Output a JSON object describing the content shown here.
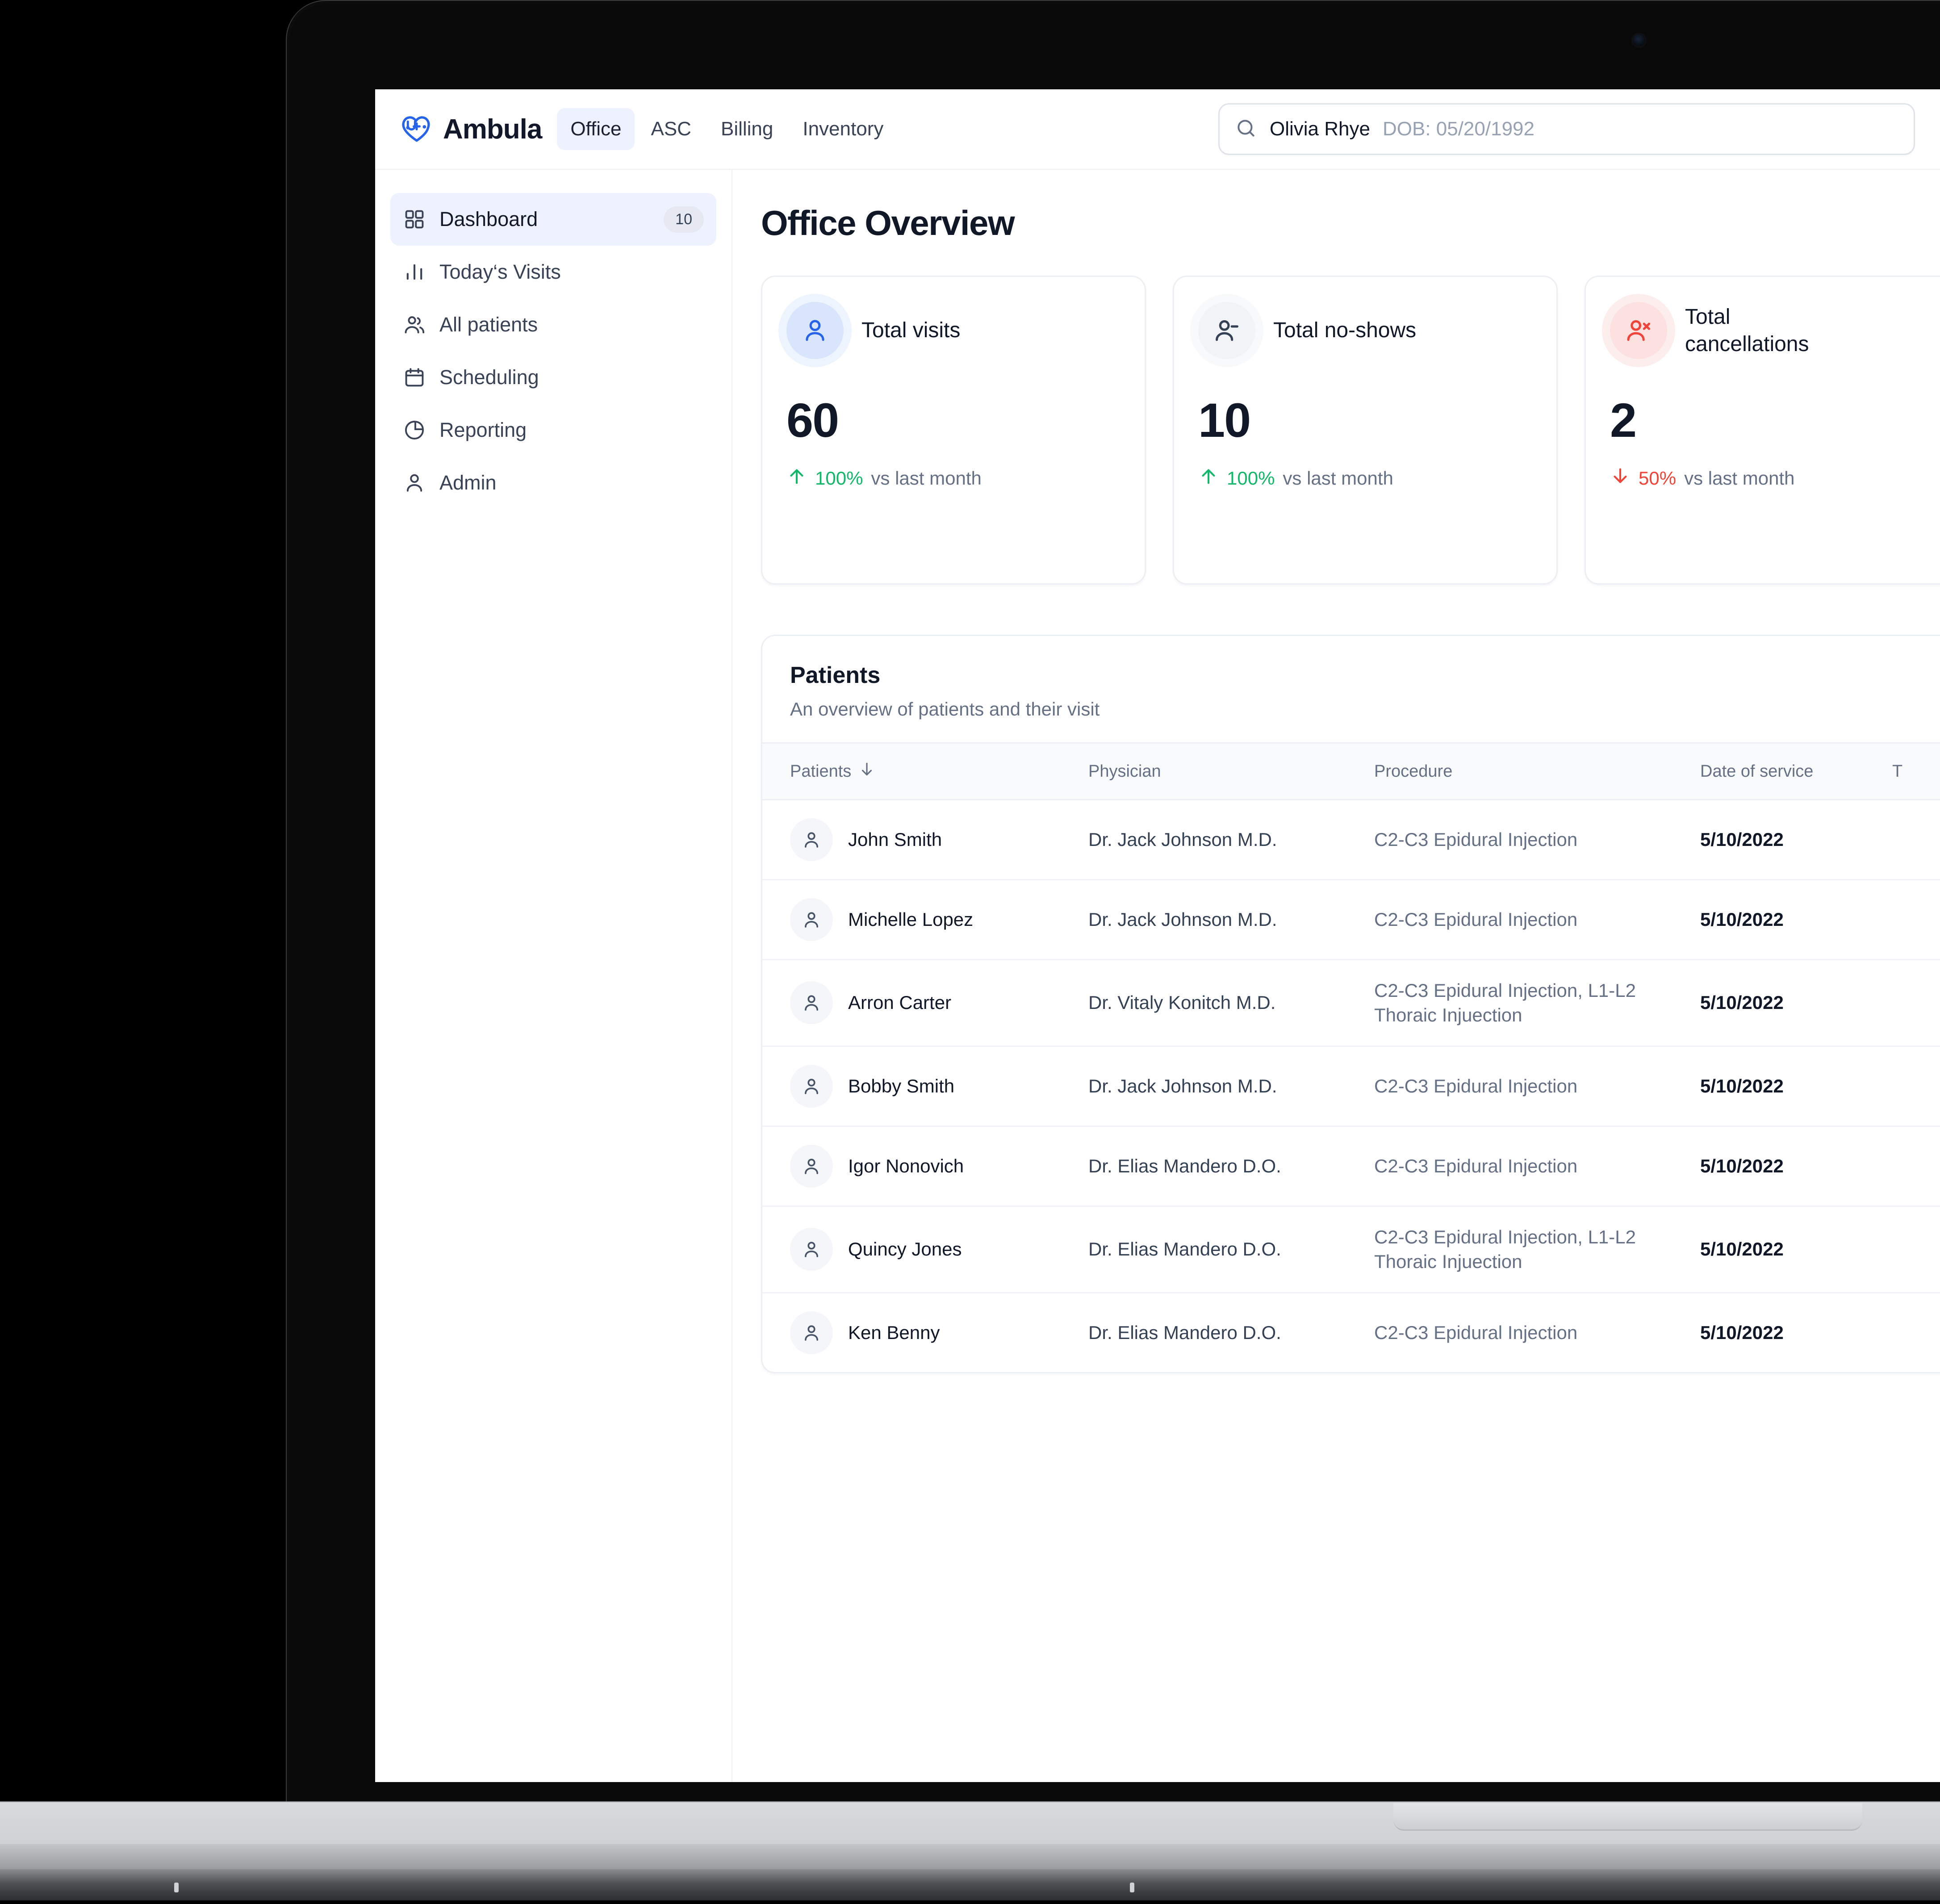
{
  "header": {
    "brand": "Ambula",
    "brand_icon": "heart-stethoscope-logo",
    "tabs": [
      {
        "label": "Office",
        "active": true
      },
      {
        "label": "ASC",
        "active": false
      },
      {
        "label": "Billing",
        "active": false
      },
      {
        "label": "Inventory",
        "active": false
      }
    ],
    "search": {
      "icon": "search-icon",
      "value": "Olivia Rhye",
      "dob": "DOB: 05/20/1992"
    }
  },
  "sidebar": {
    "items": [
      {
        "label": "Dashboard",
        "icon": "grid-icon",
        "badge": "10",
        "active": true
      },
      {
        "label": "Today‘s Visits",
        "icon": "bar-chart-icon",
        "badge": "",
        "active": false
      },
      {
        "label": "All patients",
        "icon": "users-icon",
        "badge": "",
        "active": false
      },
      {
        "label": "Scheduling",
        "icon": "calendar-icon",
        "badge": "",
        "active": false
      },
      {
        "label": "Reporting",
        "icon": "pie-chart-icon",
        "badge": "",
        "active": false
      },
      {
        "label": "Admin",
        "icon": "user-icon",
        "badge": "",
        "active": false
      }
    ]
  },
  "main": {
    "page_title": "Office Overview",
    "stats": [
      {
        "label": "Total visits",
        "value": "60",
        "icon": "user-icon",
        "tone": "blue",
        "delta_direction": "up",
        "delta_pct": "100%",
        "delta_note": "vs last month",
        "accent": "#2563EB"
      },
      {
        "label": "Total no-shows",
        "value": "10",
        "icon": "user-minus-icon",
        "tone": "gray",
        "delta_direction": "up",
        "delta_pct": "100%",
        "delta_note": "vs last month",
        "accent": "#344054"
      },
      {
        "label": "Total cancellations",
        "value": "2",
        "icon": "user-x-icon",
        "tone": "red",
        "delta_direction": "down",
        "delta_pct": "50%",
        "delta_note": "vs last month",
        "accent": "#F04438"
      }
    ],
    "table": {
      "title": "Patients",
      "subtitle": "An overview of patients and their visit",
      "columns": [
        {
          "label": "Patients",
          "sort": "↓"
        },
        {
          "label": "Physician",
          "sort": ""
        },
        {
          "label": "Procedure",
          "sort": ""
        },
        {
          "label": "Date of service",
          "sort": ""
        },
        {
          "label": "T",
          "sort": ""
        }
      ],
      "rows": [
        {
          "patient": "John Smith",
          "physician": "Dr. Jack Johnson M.D.",
          "procedure": "C2-C3 Epidural Injection",
          "date": "5/10/2022"
        },
        {
          "patient": "Michelle Lopez",
          "physician": "Dr. Jack Johnson M.D.",
          "procedure": "C2-C3 Epidural Injection",
          "date": "5/10/2022"
        },
        {
          "patient": "Arron Carter",
          "physician": "Dr. Vitaly Konitch M.D.",
          "procedure": "C2-C3 Epidural Injection, L1-L2 Thoraic Injuection",
          "date": "5/10/2022"
        },
        {
          "patient": "Bobby Smith",
          "physician": "Dr. Jack Johnson M.D.",
          "procedure": "C2-C3 Epidural Injection",
          "date": "5/10/2022"
        },
        {
          "patient": "Igor Nonovich",
          "physician": "Dr. Elias Mandero D.O.",
          "procedure": "C2-C3 Epidural Injection",
          "date": "5/10/2022"
        },
        {
          "patient": "Quincy Jones",
          "physician": "Dr. Elias Mandero D.O.",
          "procedure": "C2-C3 Epidural Injection, L1-L2 Thoraic Injuection",
          "date": "5/10/2022"
        },
        {
          "patient": "Ken Benny",
          "physician": "Dr. Elias Mandero D.O.",
          "procedure": "C2-C3 Epidural Injection",
          "date": "5/10/2022"
        }
      ]
    }
  },
  "theme": {
    "accent": "#2563EB",
    "accent_soft": "#EEF2FE",
    "text": "#101828",
    "muted": "#667085",
    "success": "#12B76A",
    "danger": "#F04438",
    "border": "#ECEFF4"
  }
}
